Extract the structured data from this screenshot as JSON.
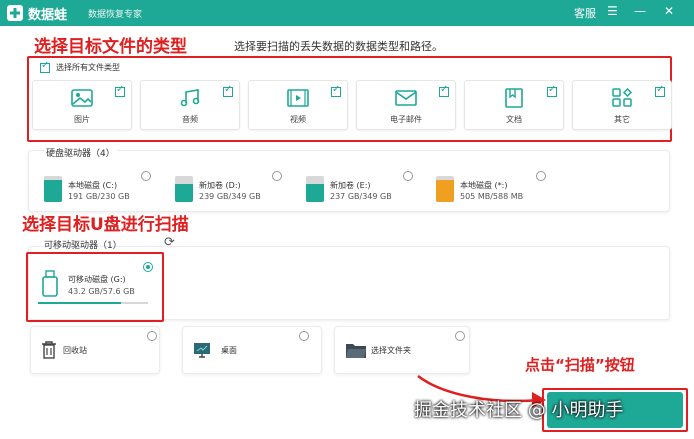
{
  "app": {
    "name": "数据蛙",
    "subtitle": "数据恢复专家",
    "menu_link": "客服"
  },
  "annotations": {
    "select_type": "选择目标文件的类型",
    "select_usb": "选择目标U盘进行扫描",
    "click_scan": "点击“扫描”按钮"
  },
  "hint": "选择要扫描的丢失数据的数据类型和路径。",
  "file_types": {
    "select_all_label": "选择所有文件类型",
    "select_all_checked": true,
    "items": [
      {
        "label": "图片",
        "icon": "image-icon",
        "checked": true
      },
      {
        "label": "音频",
        "icon": "music-icon",
        "checked": true
      },
      {
        "label": "视频",
        "icon": "video-icon",
        "checked": true
      },
      {
        "label": "电子邮件",
        "icon": "email-icon",
        "checked": true
      },
      {
        "label": "文档",
        "icon": "document-icon",
        "checked": true
      },
      {
        "label": "其它",
        "icon": "other-icon",
        "checked": true
      }
    ]
  },
  "hard_drives": {
    "title": "硬盘驱动器（4）",
    "items": [
      {
        "name": "本地磁盘 (C:)",
        "size": "191 GB/230 GB",
        "used_fraction": 0.83,
        "color": "#1ea896",
        "selected": false
      },
      {
        "name": "新加卷 (D:)",
        "size": "239 GB/349 GB",
        "used_fraction": 0.68,
        "color": "#1ea896",
        "selected": false
      },
      {
        "name": "新加卷 (E:)",
        "size": "237 GB/349 GB",
        "used_fraction": 0.68,
        "color": "#1ea896",
        "selected": false
      },
      {
        "name": "本地磁盘 (*:)",
        "size": "505 MB/588 MB",
        "used_fraction": 0.86,
        "color": "#f0a020",
        "selected": false
      }
    ]
  },
  "removable": {
    "title": "可移动驱动器（1）",
    "items": [
      {
        "name": "可移动磁盘 (G:)",
        "size": "43.2 GB/57.6 GB",
        "used_fraction": 0.75,
        "selected": true
      }
    ]
  },
  "locations": [
    {
      "label": "回收站",
      "icon": "trash-icon"
    },
    {
      "label": "桌面",
      "icon": "desktop-icon"
    },
    {
      "label": "选择文件夹",
      "icon": "folder-icon"
    }
  ],
  "watermark": "掘金技术社区 @ 小明助手",
  "colors": {
    "accent": "#1ea896",
    "annotation": "#e02020",
    "orange": "#f0a020"
  }
}
